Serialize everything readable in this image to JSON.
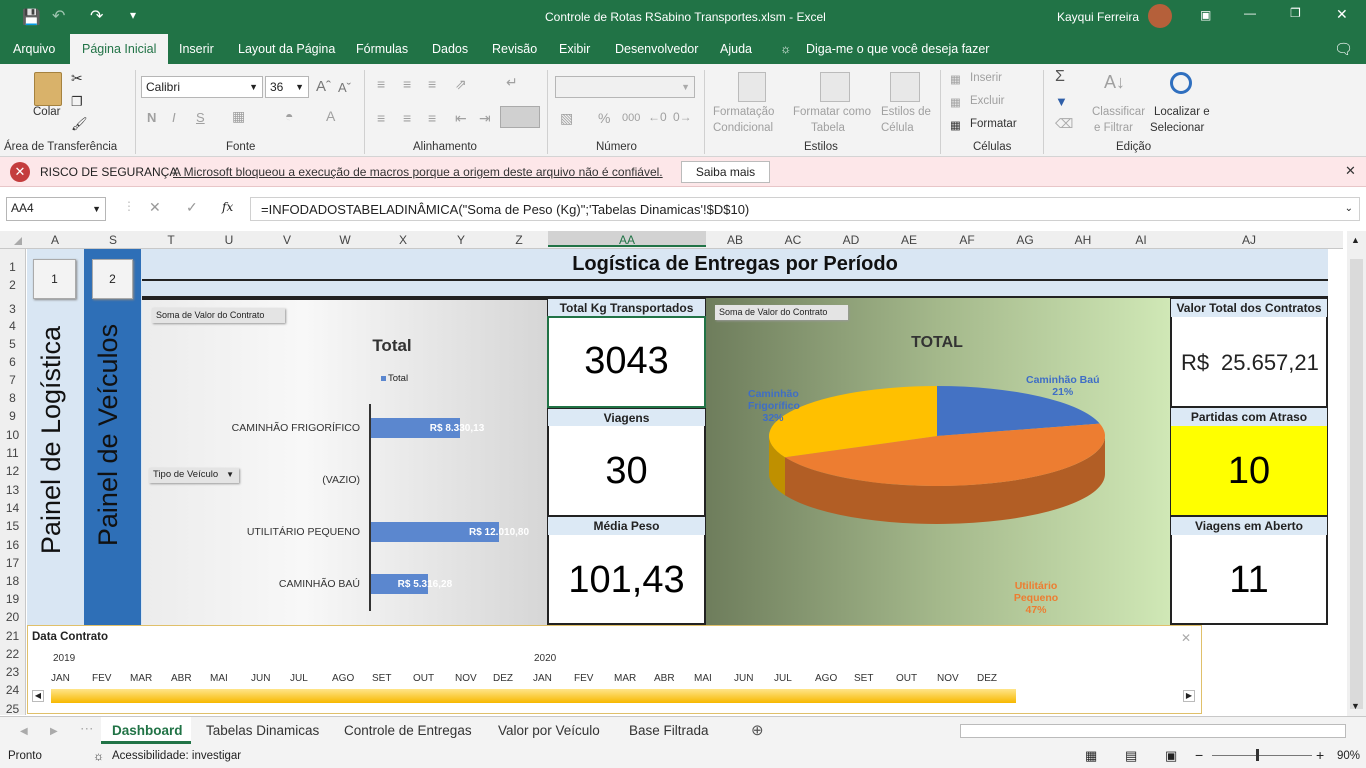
{
  "titlebar": {
    "title": "Controle de Rotas RSabino Transportes.xlsm  -  Excel",
    "user": "Kayqui Ferreira"
  },
  "ribbon_tabs": [
    "Arquivo",
    "Página Inicial",
    "Inserir",
    "Layout da Página",
    "Fórmulas",
    "Dados",
    "Revisão",
    "Exibir",
    "Desenvolvedor",
    "Ajuda",
    "Diga-me o que você deseja fazer"
  ],
  "ribbon": {
    "paste_label": "Colar",
    "clipboard_group": "Área de Transferência",
    "font_name": "Calibri",
    "font_size": "36",
    "bold": "N",
    "italic": "I",
    "underline": "S",
    "font_group": "Fonte",
    "align_group": "Alinhamento",
    "number_group": "Número",
    "number_percent": "%",
    "number_thousands": "000",
    "cond_format": [
      "Formatação",
      "Condicional"
    ],
    "format_table": [
      "Formatar como",
      "Tabela"
    ],
    "cell_styles": [
      "Estilos de",
      "Célula"
    ],
    "styles_group": "Estilos",
    "insert": "Inserir",
    "delete": "Excluir",
    "format": "Formatar",
    "cells_group": "Células",
    "sort_filter": [
      "Classificar",
      "e Filtrar"
    ],
    "find_select": [
      "Localizar e",
      "Selecionar"
    ],
    "editing_group": "Edição"
  },
  "security": {
    "title": "RISCO DE SEGURANÇA",
    "message": "A Microsoft bloqueou a execução de macros porque a origem deste arquivo não é confiável.",
    "button": "Saiba mais"
  },
  "formula_bar": {
    "name_box": "AA4",
    "fx": "fx",
    "formula": "=INFODADOSTABELADINÂMICA(\"Soma de Peso (Kg)\";'Tabelas Dinamicas'!$D$10)"
  },
  "columns": [
    "A",
    "S",
    "T",
    "U",
    "V",
    "W",
    "X",
    "Y",
    "Z",
    "AA",
    "AB",
    "AC",
    "AD",
    "AE",
    "AF",
    "AG",
    "AH",
    "AI",
    "AJ"
  ],
  "rows": [
    "1",
    "2",
    "3",
    "4",
    "5",
    "6",
    "7",
    "8",
    "9",
    "10",
    "11",
    "12",
    "13",
    "14",
    "15",
    "16",
    "17",
    "18",
    "19",
    "20",
    "21",
    "22",
    "23",
    "24",
    "25"
  ],
  "dashboard": {
    "title": "Logística de Entregas por Período",
    "btn1": "1",
    "btn2": "2",
    "side1": "Painel de Logística",
    "side2": "Painel de Veículos",
    "kg_title": "Total Kg Transportados",
    "kg_value": "3043",
    "trips_title": "Viagens",
    "trips_value": "30",
    "avg_title": "Média Peso",
    "avg_value": "101,43",
    "contracts_title": "Valor Total dos Contratos",
    "contracts_currency": "R$",
    "contracts_value": "25.657,21",
    "late_title": "Partidas com Atraso",
    "late_value": "10",
    "open_title": "Viagens em Aberto",
    "open_value": "11"
  },
  "chart_data": [
    {
      "type": "bar",
      "field_button": "Soma de Valor do Contrato",
      "axis_button": "Tipo de Veículo",
      "title": "Total",
      "legend": "Total",
      "categories": [
        "CAMINHÃO FRIGORÍFICO",
        "(VAZIO)",
        "UTILITÁRIO PEQUENO",
        "CAMINHÃO BAÚ"
      ],
      "values": [
        8330.13,
        0,
        12010.8,
        5316.28
      ],
      "labels": [
        "R$ 8.330,13",
        "",
        "R$ 12.010,80",
        "R$ 5.316,28"
      ]
    },
    {
      "type": "pie",
      "field_button": "Soma de Valor do Contrato",
      "title": "TOTAL",
      "slices": [
        {
          "name": "Caminhão Baú",
          "percent": "21%",
          "value": 21,
          "color": "#4472c4"
        },
        {
          "name": "Utilitário Pequeno",
          "percent": "47%",
          "value": 47,
          "color": "#ed7d31"
        },
        {
          "name": "Caminhão Frigorífico",
          "percent": "32%",
          "value": 32,
          "color": "#ffc000"
        }
      ]
    }
  ],
  "timeline": {
    "title": "Data Contrato",
    "year1": "2019",
    "year2": "2020",
    "months": [
      "JAN",
      "FEV",
      "MAR",
      "ABR",
      "MAI",
      "JUN",
      "JUL",
      "AGO",
      "SET",
      "OUT",
      "NOV",
      "DEZ",
      "JAN",
      "FEV",
      "MAR",
      "ABR",
      "MAI",
      "JUN",
      "JUL",
      "AGO",
      "SET",
      "OUT",
      "NOV",
      "DEZ"
    ]
  },
  "sheet_tabs": [
    "Dashboard",
    "Tabelas Dinamicas",
    "Controle de Entregas",
    "Valor por Veículo",
    "Base Filtrada"
  ],
  "status": {
    "ready": "Pronto",
    "accessibility": "Acessibilidade: investigar",
    "zoom": "90%"
  }
}
